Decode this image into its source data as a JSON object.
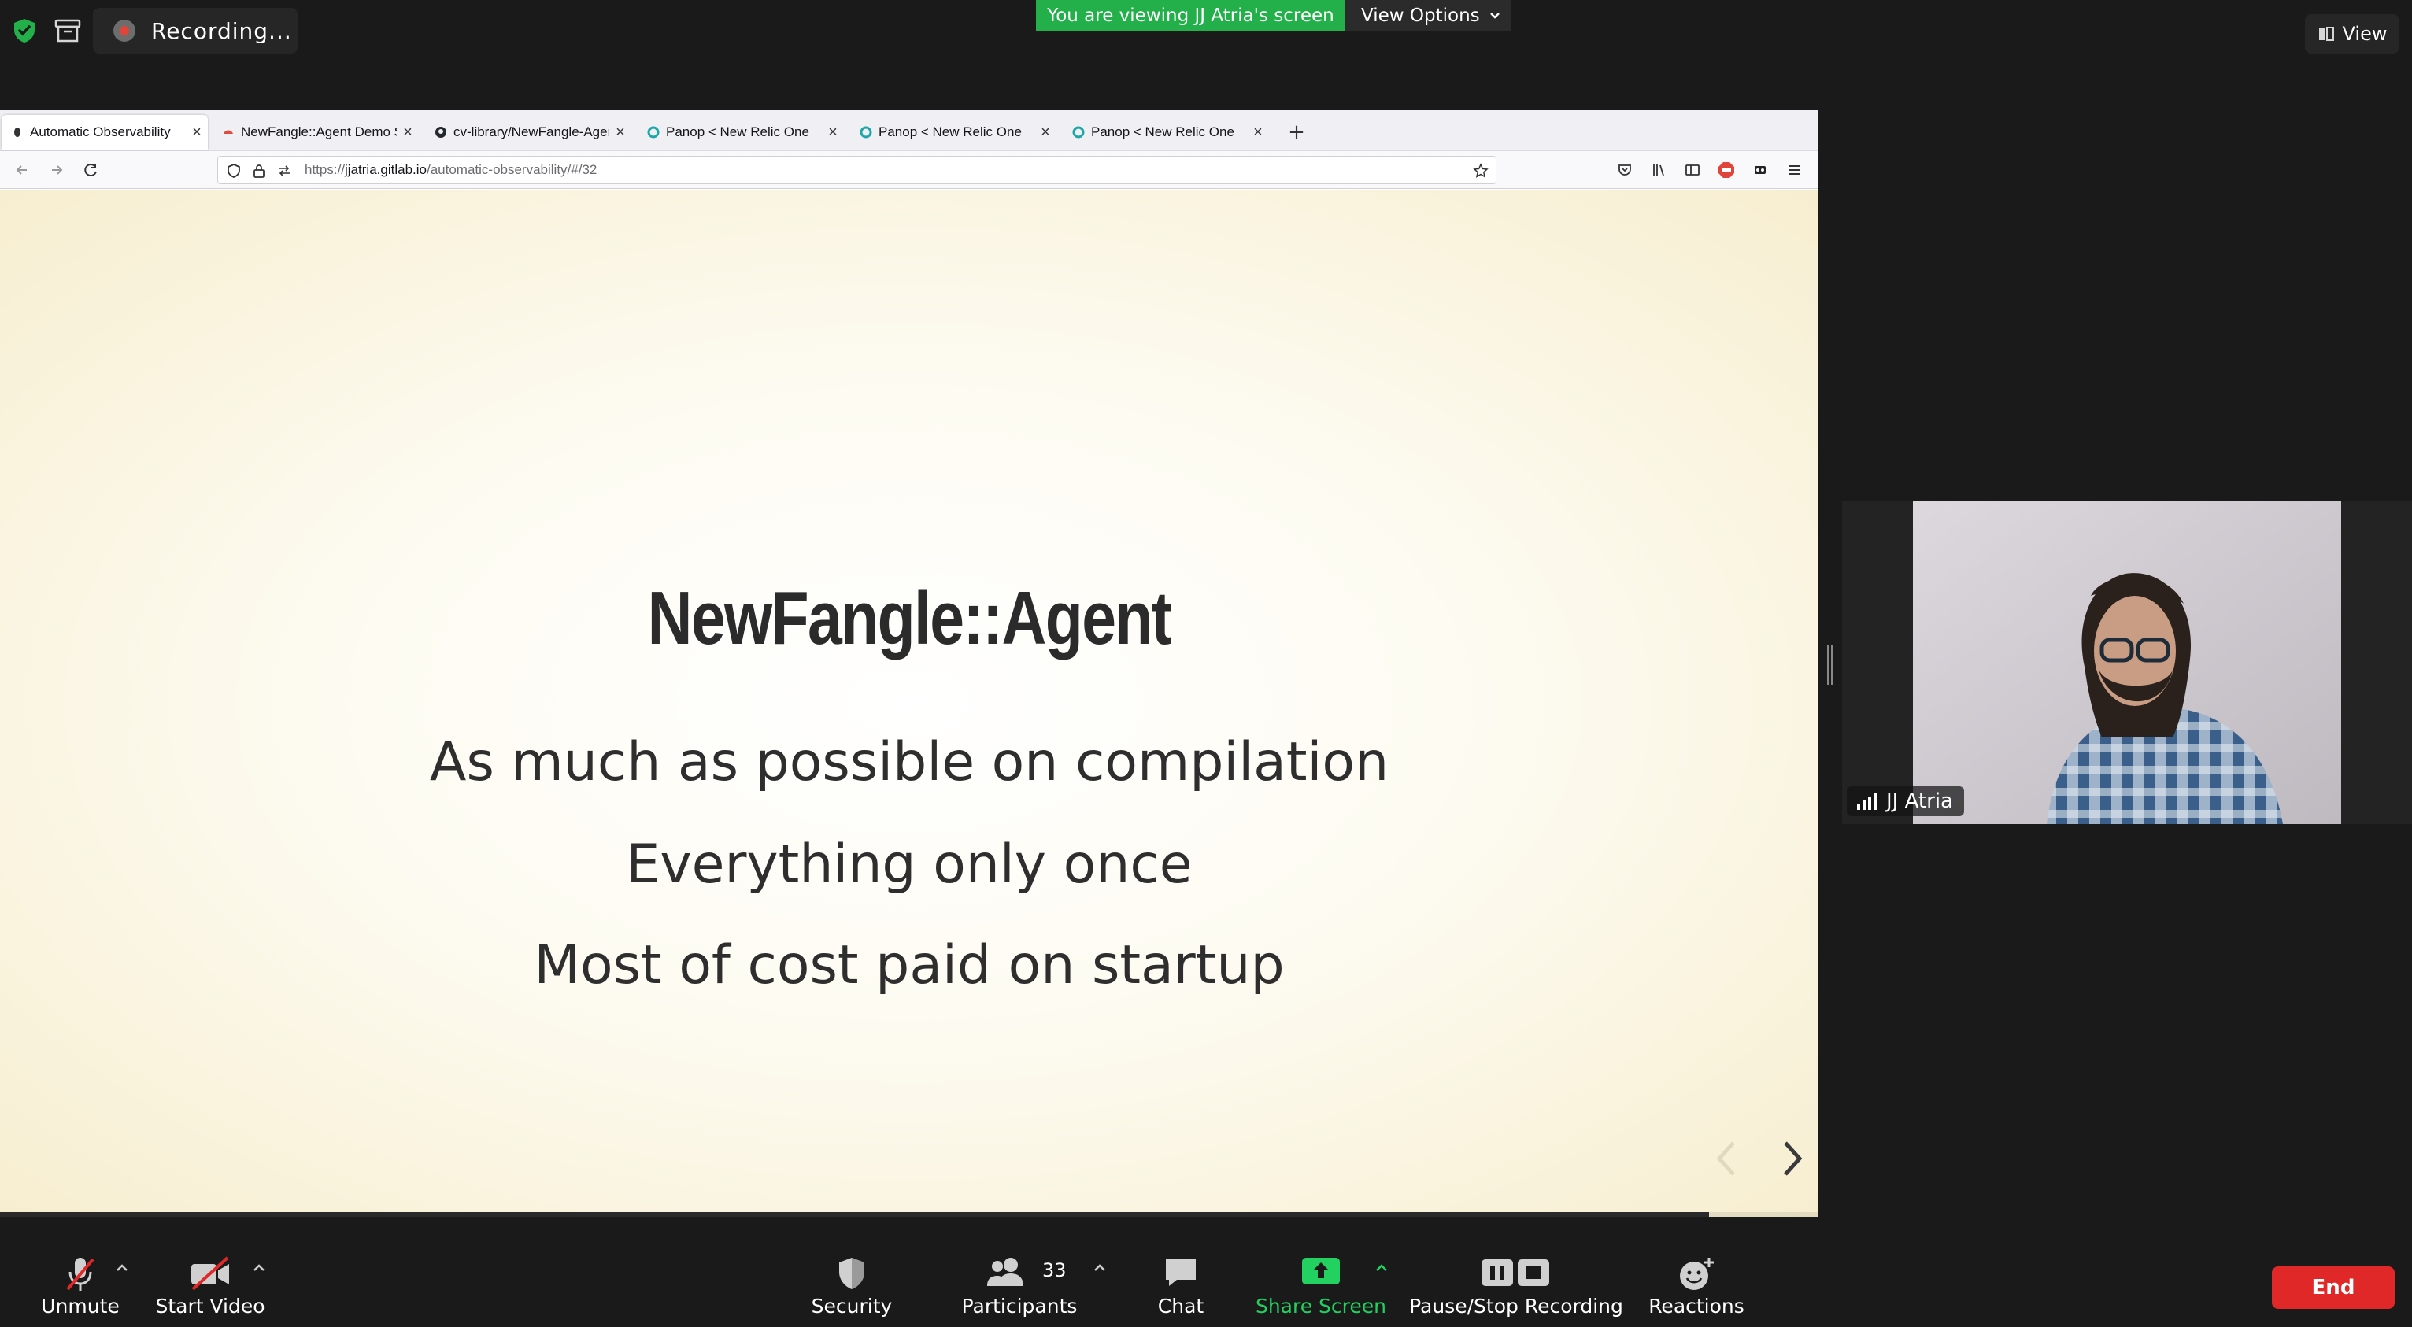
{
  "meeting": {
    "recording_label": "Recording...",
    "viewing_banner": "You are viewing JJ Atria's screen",
    "view_options_label": "View Options",
    "view_button_label": "View"
  },
  "browser": {
    "tabs": [
      {
        "title": "Automatic Observability",
        "active": true
      },
      {
        "title": "NewFangle::Agent Demo S",
        "active": false
      },
      {
        "title": "cv-library/NewFangle-Agen",
        "active": false
      },
      {
        "title": "Panop < New Relic One",
        "active": false
      },
      {
        "title": "Panop < New Relic One",
        "active": false
      },
      {
        "title": "Panop < New Relic One",
        "active": false
      }
    ],
    "url_prefix": "https://",
    "url_host": "jjatria.gitlab.io",
    "url_path": "/automatic-observability/#/32"
  },
  "slide": {
    "title": "NewFangle::Agent",
    "lines": [
      "As much as possible on compilation",
      "Everything only once",
      "Most of cost paid on startup"
    ],
    "progress_fraction": 0.94
  },
  "participant": {
    "name": "JJ Atria"
  },
  "toolbar": {
    "unmute": "Unmute",
    "start_video": "Start Video",
    "security": "Security",
    "participants": "Participants",
    "participants_count": "33",
    "chat": "Chat",
    "share_screen": "Share Screen",
    "pause_stop": "Pause/Stop Recording",
    "reactions": "Reactions",
    "end": "End"
  },
  "colors": {
    "share_green": "#23d160",
    "end_red": "#e02828",
    "banner_green": "#23b04a"
  }
}
